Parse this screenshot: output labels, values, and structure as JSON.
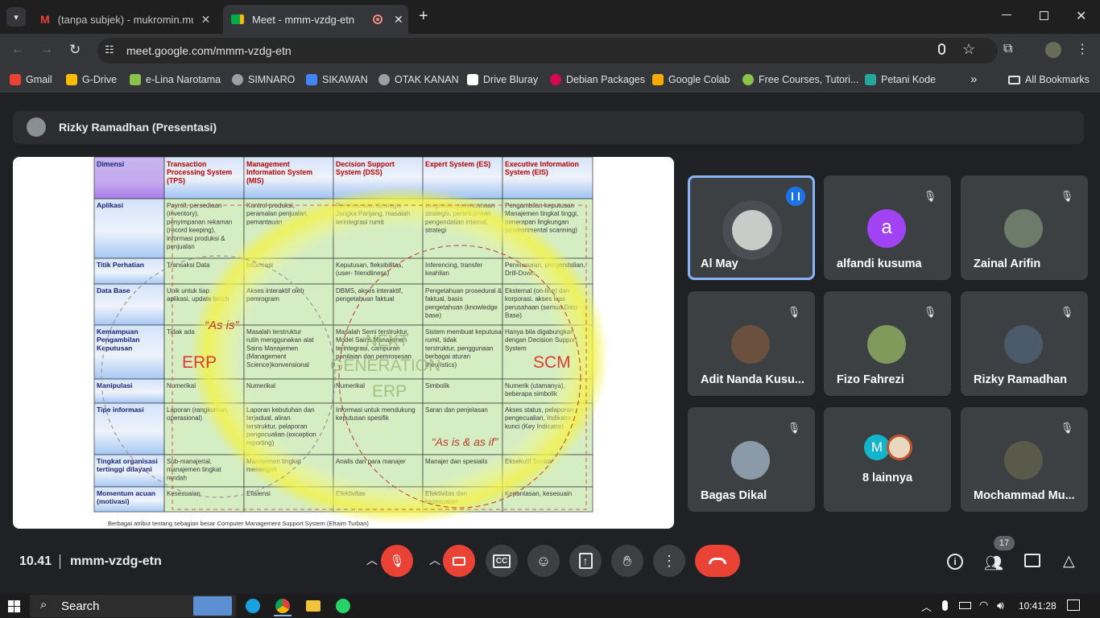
{
  "browser": {
    "tabs": [
      {
        "title": "(tanpa subjek) - mukromin.mu"
      },
      {
        "title": "Meet - mmm-vzdg-etn"
      }
    ],
    "url": "meet.google.com/mmm-vzdg-etn",
    "bookmarks": [
      {
        "label": "Gmail",
        "color": "#ea4335"
      },
      {
        "label": "G-Drive",
        "color": "#fbbc04"
      },
      {
        "label": "e-Lina Narotama",
        "color": "#8bc34a"
      },
      {
        "label": "SIMNARO",
        "color": "#9aa0a6"
      },
      {
        "label": "SIKAWAN",
        "color": "#4285f4"
      },
      {
        "label": "OTAK KANAN",
        "color": "#9aa0a6"
      },
      {
        "label": "Drive Bluray",
        "color": "#ffffff"
      },
      {
        "label": "Debian Packages",
        "color": "#d70751"
      },
      {
        "label": "Google Colab",
        "color": "#f9ab00"
      },
      {
        "label": "Free Courses, Tutori...",
        "color": "#8bc34a"
      },
      {
        "label": "Petani Kode",
        "color": "#26a69a"
      }
    ],
    "all_bookmarks": "All Bookmarks"
  },
  "meet": {
    "presenter": "Rizky Ramadhan (Presentasi)",
    "time": "10.41",
    "meeting_code": "mmm-vzdg-etn",
    "participant_count": "17",
    "participants": [
      {
        "name": "Al May",
        "speaking": true,
        "avatar_color": "#5f6368"
      },
      {
        "name": "alfandi kusuma",
        "avatar_letter": "a",
        "avatar_color": "#a142f4"
      },
      {
        "name": "Zainal Arifin",
        "avatar_color": "#6d7b6a"
      },
      {
        "name": "Adit Nanda Kusu...",
        "avatar_color": "#6b4f3f"
      },
      {
        "name": "Fizo Fahrezi",
        "avatar_color": "#7f9a5a"
      },
      {
        "name": "Rizky Ramadhan",
        "avatar_color": "#4a5a6a"
      },
      {
        "name": "Bagas Dikal",
        "avatar_color": "#8a9aa8"
      },
      {
        "name": "8 lainnya",
        "avatar_letter": "M",
        "avatar_color": "#12b5cb"
      },
      {
        "name": "Mochammad Mu...",
        "avatar_color": "#5a5a4a"
      }
    ]
  },
  "slide": {
    "headers": [
      "Dimensi",
      "Transaction Processing System (TPS)",
      "Management Information System (MIS)",
      "Decision Support System (DSS)",
      "Expert System (ES)",
      "Executive Information System (EIS)"
    ],
    "rows": [
      [
        "Aplikasi",
        "Payroll, persediaan (inventory), penyimpanan rekaman (record keeping), informasi produksi & penjualan",
        "Kontrol produksi, peramalan penjualan, pemantauan",
        "Perencanaan Strategis Jangka Panjang, masalah terintegrasi rumit",
        "Diagnosis, perencanaan strategis, perencanaan pengendalian internal, strategi",
        "Pengambilan keputusan Manajemen tingkat tinggi, penerapan lingkungan (environmental scanning)"
      ],
      [
        "Titik Perhatian",
        "Transaksi Data",
        "Informasi",
        "Keputusan, fleksibilitas, (user- friendliness)",
        "Inferencing, transfer keahlian",
        "Penelusuran, pengendalian, Drill-Down"
      ],
      [
        "Data Base",
        "Unik untuk tiap aplikasi, update batch",
        "Akses interaktif oleh pemrogram",
        "DBMS, akses interaktif, pengetahuan faktual",
        "Pengetahuan prosedural & faktual, basis pengetahuan (knowledge base)",
        "Eksternal (on-line) dan korporasi, akses luas perusahaan (semua Data Base)"
      ],
      [
        "Kemampuan Pengambilan Keputusan",
        "Tidak ada",
        "Masalah terstruktur rutin menggunakan alat Sains Manajemen (Management Science)konvensional",
        "Masalah Semi terstruktur, Model Sains Manajemen terintegrasi, campuran penilaian dan pemrosesan",
        "Sistem membuat keputusan rumit, tidak terstruktur, penggunaan berbagai aturan (heuristics)",
        "Hanya bila digabungkan dengan Decision Support System"
      ],
      [
        "Manipulasi",
        "Numerikal",
        "Numerikal",
        "Numerikal",
        "Simbolik",
        "Numerik (utamanya), beberapa simbolik"
      ],
      [
        "Tipe informasi",
        "Laporan (rangkuman, operasional)",
        "Laporan kebutuhan dan terjadual, aliran terstruktur, pelaporan pengecualian (exception reporting)",
        "Informasi untuk mendukung keputusan spesifik",
        "Saran dan penjelasan",
        "Akses status, pelaporan pengecualian, Indikator kunci (Key Indicator)"
      ],
      [
        "Tingkat organisasi tertinggi dilayani",
        "Sub-manajerial, manajemen tingkat rendah",
        "Manajemen tingkat menengah",
        "Analis dan para manajer",
        "Manajer dan spesialis",
        "Eksekutif Senior"
      ],
      [
        "Momentum acuan (motivasi)",
        "Kesesuaian",
        "Efisiensi",
        "Efektivitas",
        "Efektivitas dan kesesuaian",
        "Kepantasan, kesesuain"
      ]
    ],
    "overlay": {
      "as_is": "“As is”",
      "erp": "ERP",
      "next_gen_1": "NEXT",
      "next_gen_2": "GENERATION",
      "next_gen_3": "ERP",
      "scm": "SCM",
      "as_is_as_if": "“As is & as if”"
    },
    "caption": "Berbagai atribut tentang sebagian besar Computer Management Support System (Efraim Turban)"
  },
  "taskbar": {
    "search": "Search",
    "clock": "10:41:28"
  }
}
